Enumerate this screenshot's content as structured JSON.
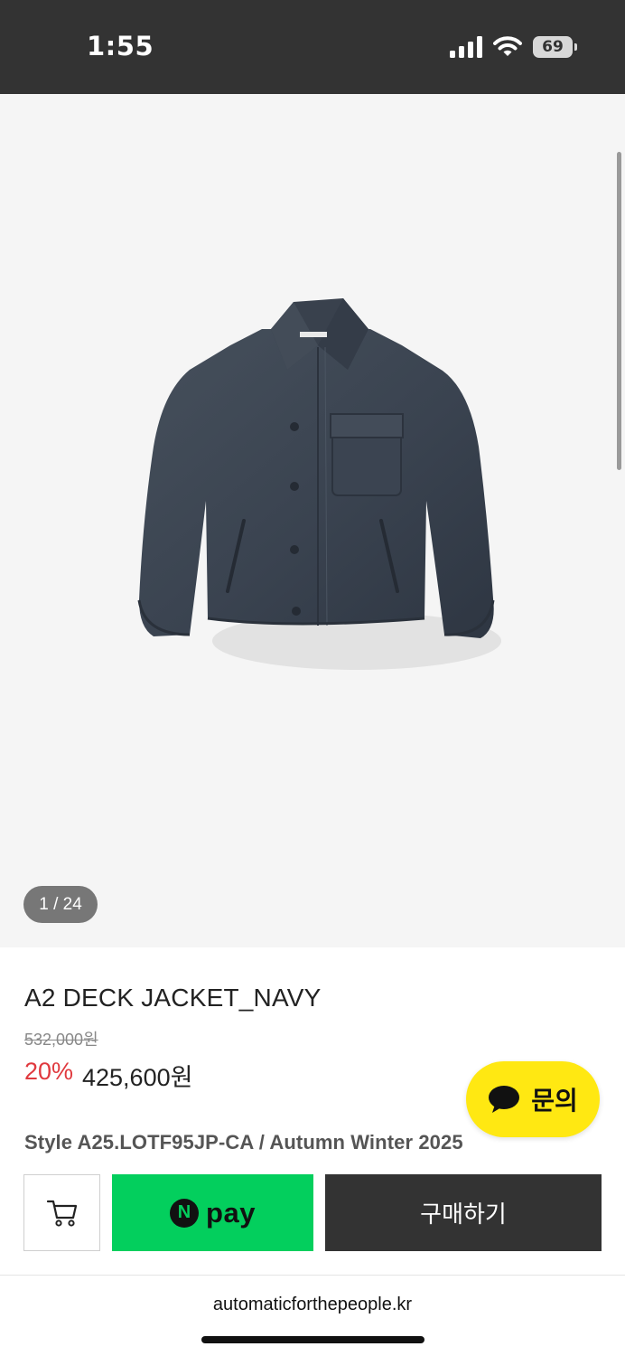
{
  "status_bar": {
    "time": "1:55",
    "battery": "69",
    "icons": [
      "signal-icon",
      "wifi-icon",
      "battery-icon"
    ]
  },
  "gallery": {
    "counter": "1 / 24",
    "image": "navy-deck-jacket-image"
  },
  "product": {
    "title": "A2 DECK JACKET_NAVY",
    "original_price": "532,000원",
    "discount_rate": "20%",
    "sale_price": "425,600원",
    "style_line": "Style A25.LOTF95JP-CA / Autumn Winter 2025"
  },
  "inquiry": {
    "label": "문의",
    "icon": "chat-bubble-icon"
  },
  "actions": {
    "cart_icon": "cart-icon",
    "npay_badge": "N",
    "npay_label": "pay",
    "buy_label": "구매하기"
  },
  "browser": {
    "url": "automaticforthepeople.kr"
  },
  "colors": {
    "status_bar": "#333333",
    "discount": "#e0393e",
    "npay": "#03cf5d",
    "inquiry": "#ffe812",
    "buy_button": "#333333"
  }
}
